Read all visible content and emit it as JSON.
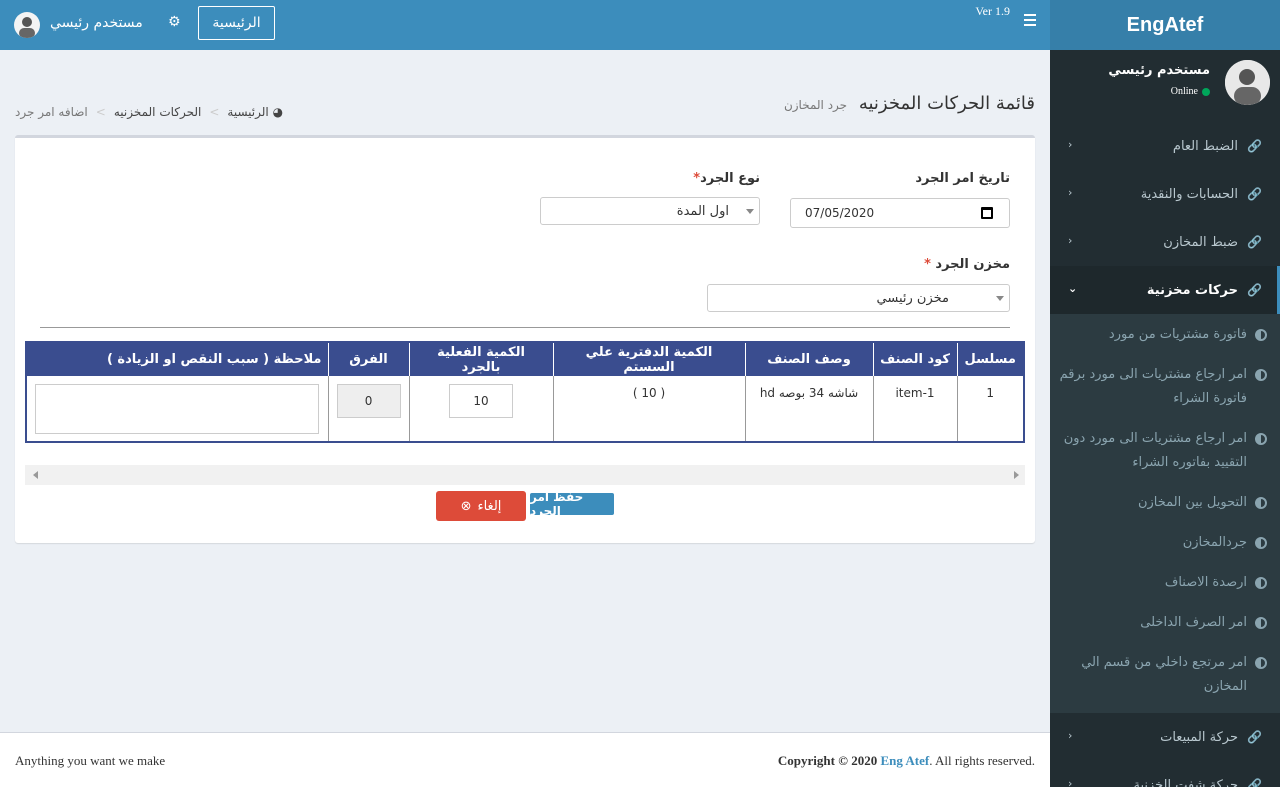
{
  "header": {
    "version": "Ver 1.9",
    "home_button": "الرئيسية",
    "user_name": "مستخدم رئيسي"
  },
  "sidebar": {
    "brand": "EngAtef",
    "user_name": "مستخدم رئيسي",
    "status": "Online",
    "items": [
      {
        "label": "الضبط العام"
      },
      {
        "label": "الحسابات والنقدية"
      },
      {
        "label": "ضبط المخازن"
      },
      {
        "label": "حركات مخزنية"
      },
      {
        "label": "حركة المبيعات"
      },
      {
        "label": "حركة شفت الخزنية"
      }
    ],
    "submenu": [
      {
        "label": "فاتورة مشتريات من مورد"
      },
      {
        "label": "امر ارجاع مشتريات الى مورد برقم فاتورة الشراء"
      },
      {
        "label": "امر ارجاع مشتريات الى مورد دون التقييد بفاتوره الشراء"
      },
      {
        "label": "التحويل بين المخازن"
      },
      {
        "label": "جردالمخازن"
      },
      {
        "label": "ارصدة الاصناف"
      },
      {
        "label": "امر الصرف الداخلى"
      },
      {
        "label": "امر مرتجع داخلي من قسم الي المخازن"
      }
    ]
  },
  "page": {
    "title": "قائمة الحركات المخزنيه",
    "subtitle": "جرد المخازن",
    "breadcrumb": [
      "الرئيسية",
      "الحركات المخزنيه",
      "اضافه امر جرد"
    ]
  },
  "form": {
    "date_label": "تاريخ امر الجرد",
    "date_value": "07/05/2020",
    "type_label": "نوع الجرد",
    "type_value": "اول المدة",
    "store_label": "مخزن الجرد",
    "store_value": "مخزن رئيسي",
    "required_mark": "*"
  },
  "table": {
    "headers": [
      "مسلسل",
      "كود الصنف",
      "وصف الصنف",
      "الكمية الدفترية علي السستم",
      "الكمية الفعلية بالجرد",
      "الفرق",
      "ملاحظة ( سبب النقص او الزيادة )"
    ],
    "rows": [
      {
        "serial": "1",
        "code": "item-1",
        "desc": "شاشه 34 بوصه hd",
        "book_qty": "( 10 )",
        "actual_qty": "10",
        "diff": "0",
        "note": ""
      }
    ]
  },
  "buttons": {
    "save": "حفظ امر الجرد",
    "cancel": "إلغاء"
  },
  "footer": {
    "left": "Anything you want we make",
    "copyright_prefix": "Copyright © 2020",
    "brand": "Eng Atef",
    "copyright_suffix": ". All rights reserved."
  },
  "colors": {
    "header": "#3c8dbc",
    "sidebar": "#222d32",
    "table_header": "#3a4d8f",
    "cancel": "#dd4b39"
  }
}
